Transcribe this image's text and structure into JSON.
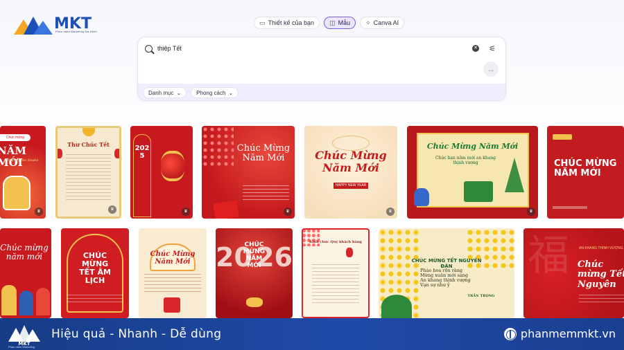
{
  "brand": {
    "name": "MKT",
    "tagline": "Phần mềm Marketing Đa Kênh"
  },
  "tabs": [
    {
      "label": "Thiết kế của bạn",
      "icon": "folder-icon",
      "active": false
    },
    {
      "label": "Mẫu",
      "icon": "template-icon",
      "active": true
    },
    {
      "label": "Canva AI",
      "icon": "sparkle-icon",
      "active": false
    }
  ],
  "search": {
    "value": "thiệp Tết"
  },
  "filters": [
    {
      "label": "Danh mục"
    },
    {
      "label": "Phong cách"
    }
  ],
  "cards": {
    "r1c1": {
      "title": "NĂM MỚI",
      "badge": "Chúc mừng",
      "sub": "Year of the Snake"
    },
    "r1c2": {
      "title": "Thư Chúc Tết"
    },
    "r1c3": {
      "title": "2025"
    },
    "r1c4": {
      "title": "Chúc Mừng Năm Mới"
    },
    "r1c5": {
      "title": "Chúc Mừng Năm Mới",
      "sub": "HAPPY NEW YEAR"
    },
    "r1c6": {
      "title": "Chúc Mừng Năm Mới",
      "sub": "Chúc bạn năm mới an khang thịnh vượng"
    },
    "r1c7": {
      "title": "CHÚC MỪNG NĂM MỚI"
    },
    "r2c1": {
      "title": "Chúc mừng năm mới"
    },
    "r2c2": {
      "title": "CHÚC MỪNG TẾT ÂM LỊCH"
    },
    "r2c3": {
      "title": "Chúc Mừng Năm Mới"
    },
    "r2c4": {
      "title": "CHÚC MỪNG NĂM MỚI",
      "num_left": "20",
      "num_right": "26"
    },
    "r2c5": {
      "title": "Kính chúc Quý khách hàng"
    },
    "r2c6": {
      "title": "CHÚC MỪNG TẾT NGUYÊN ĐÁN",
      "sub": "Pháo hoa rộn ràng\nMừng xuân mới sang\nAn khang thịnh vượng\nVạn sự như ý",
      "sign": "TRẦN TRỌNG"
    },
    "r2c7": {
      "title": "Chúc mừng Tết Nguyên",
      "badge": "AN KHANG THỊNH VƯỢNG"
    }
  },
  "footer": {
    "slogan": "Hiệu quả - Nhanh  - Dễ dùng",
    "site": "phanmemmkt.vn",
    "logo_sub": "Phần mềm Marketing"
  },
  "colors": {
    "accent": "#7b5ce0",
    "brand_blue": "#1f4aa8",
    "tet_red": "#c8191f",
    "gold": "#f2c14e"
  }
}
